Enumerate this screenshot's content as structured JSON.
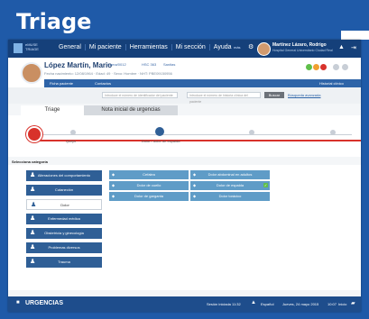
{
  "banner": {
    "title": "Triage"
  },
  "app": {
    "logo_text_1": "eMUSE",
    "logo_text_2": "TRIAGE",
    "nav": [
      "General",
      "Mi paciente",
      "Herramientas",
      "Mi sección",
      "Ayuda"
    ],
    "more_label": "más",
    "user_name": "Martínez Lázaro, Rodrigo",
    "user_subtitle": "Hospital General Universitario Ciudad Real"
  },
  "patient": {
    "name": "López Martín, Mario",
    "info": "Fecha nacimiento: 12/08/1964 · Edad: 49 · Sexo: Hombre · NHT: PBE09150956",
    "center": "Cama/0012",
    "room": "HSC 363",
    "status": "Sanitas",
    "tabs": [
      "Ficha paciente",
      "Contactos",
      "Historial clínico"
    ]
  },
  "search": {
    "placeholder_1": "Introduce el número de identificador del paciente",
    "placeholder_2": "Introduce el número de historia clínica del paciente",
    "button": "Buscar",
    "advanced": "Búsqueda avanzada"
  },
  "tabs": [
    "Triage",
    "Nota inicial de urgencias"
  ],
  "progress": {
    "steps": [
      "Queja",
      "Dolor / dolor de espalda",
      "",
      ""
    ],
    "current_step": 2
  },
  "categories": {
    "label": "Selecciona categoría",
    "left": [
      {
        "label": "Alteraciones del comportamiento",
        "icon": "person-icon",
        "selected": false
      },
      {
        "label": "Cutaneción",
        "icon": "person-icon",
        "selected": false
      },
      {
        "label": "Dolor",
        "icon": "person-icon",
        "selected": true
      },
      {
        "label": "Enfermedad médica",
        "icon": "person-icon",
        "selected": false
      },
      {
        "label": "Obstetricia y ginecología",
        "icon": "person-icon",
        "selected": false
      },
      {
        "label": "Problemas diversos",
        "icon": "person-icon",
        "selected": false
      },
      {
        "label": "Trauma",
        "icon": "person-icon",
        "selected": false
      }
    ],
    "grid": [
      {
        "label": "Cefalea",
        "checked": false
      },
      {
        "label": "Dolor abdominal en adultos",
        "checked": false
      },
      {
        "label": "Dolor de cuello",
        "checked": false
      },
      {
        "label": "Dolor de espalda",
        "checked": true
      },
      {
        "label": "Dolor de garganta",
        "checked": false
      },
      {
        "label": "Dolor torácico",
        "checked": false
      }
    ]
  },
  "footer": {
    "title": "URGENCIAS",
    "session": "Sesión iniciada 11:32",
    "language": "Español",
    "date": "Jueves, 24 mayo 2015",
    "time": "10:07",
    "help": "Inicio"
  },
  "colors": {
    "primary": "#1f5aa8",
    "dark": "#15407a",
    "accent_red": "#d8322b",
    "category_blue": "#2f5f96",
    "grid_blue": "#5f9cc7",
    "check_green": "#5fbf4a"
  }
}
